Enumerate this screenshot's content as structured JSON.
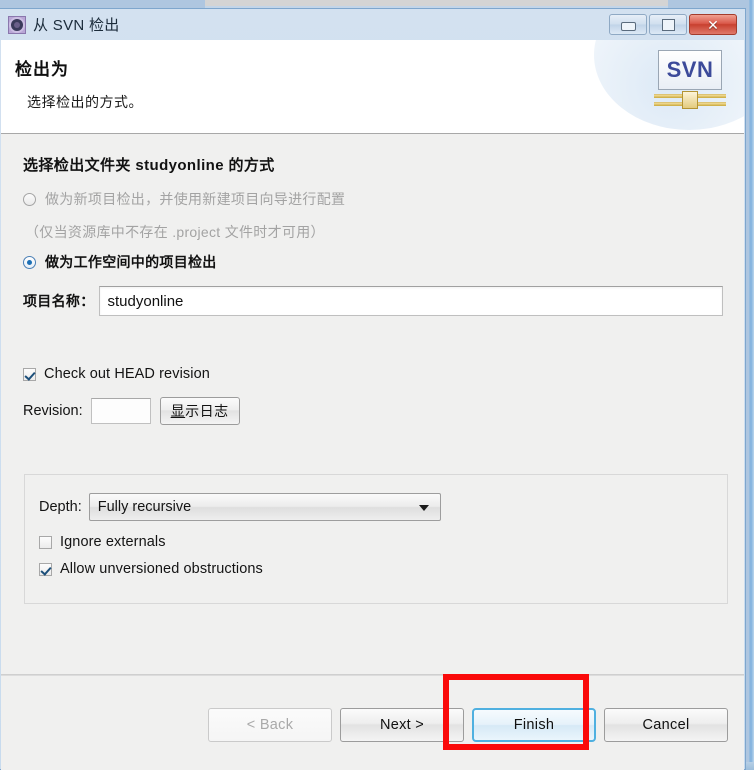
{
  "window": {
    "title": "从 SVN 检出",
    "icon": "svn-gear-icon",
    "controls": {
      "minimize": "—",
      "maximize": "▢",
      "close": "✕"
    }
  },
  "header": {
    "title": "检出为",
    "subtitle": "选择检出的方式。",
    "logo_text": "SVN"
  },
  "main": {
    "section_title": "选择检出文件夹 studyonline 的方式",
    "radios": [
      {
        "label": "做为新项目检出，并使用新建项目向导进行配置",
        "selected": false,
        "disabled": true
      },
      {
        "label": "做为工作空间中的项目检出",
        "selected": true,
        "disabled": false
      }
    ],
    "radio_note": "（仅当资源库中不存在 .project 文件时才可用）",
    "project_name": {
      "label": "项目名称：",
      "value": "studyonline",
      "placeholder": ""
    },
    "head_revision": {
      "label": "Check out HEAD revision",
      "checked": true
    },
    "revision": {
      "label": "Revision:",
      "value": "",
      "placeholder": "",
      "show_log_button": "显示日志",
      "show_log_mnemonic": "显"
    },
    "depth_group": {
      "depth_label": "Depth:",
      "depth_value": "Fully recursive",
      "depth_options": [
        "Fully recursive"
      ],
      "ignore_externals": {
        "label": "Ignore externals",
        "checked": false
      },
      "allow_unversioned": {
        "label": "Allow unversioned obstructions",
        "checked": true
      }
    }
  },
  "footer": {
    "buttons": [
      {
        "label": "< Back",
        "disabled": true,
        "is_default": false
      },
      {
        "label": "Next >",
        "disabled": false,
        "is_default": false
      },
      {
        "label": "Finish",
        "disabled": false,
        "is_default": true
      },
      {
        "label": "Cancel",
        "disabled": false,
        "is_default": false
      }
    ]
  },
  "annotation": {
    "color": "#fa0a0a",
    "target": "Finish"
  },
  "colors": {
    "title_bar": "#c8dbee",
    "dialog_bg": "#f0f0ef",
    "header_bg": "#ffffff",
    "accent_blue": "#4fb0e0",
    "svn_text": "#3c4a9a",
    "annotation_red": "#fa0a0a"
  }
}
